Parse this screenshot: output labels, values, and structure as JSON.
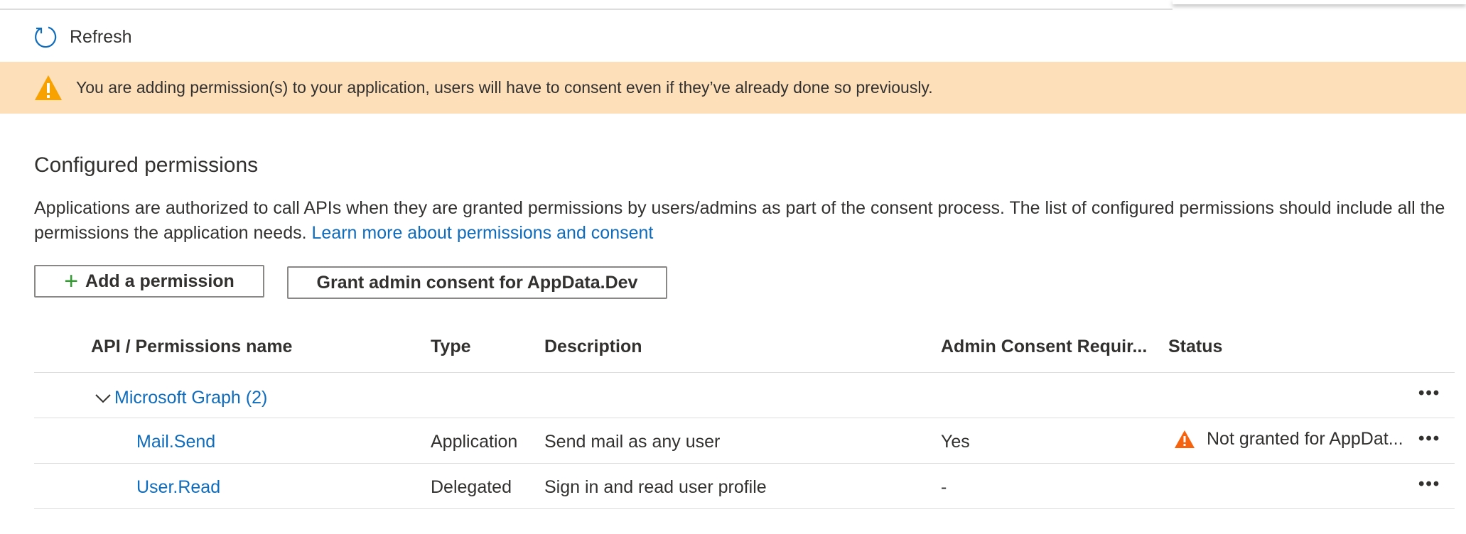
{
  "toolbar": {
    "refresh_label": "Refresh"
  },
  "banner": {
    "text": "You are adding permission(s) to your application, users will have to consent even if they’ve already done so previously."
  },
  "section": {
    "title": "Configured permissions",
    "description": "Applications are authorized to call APIs when they are granted permissions by users/admins as part of the consent process. The list of configured permissions should include all the permissions the application needs.",
    "learn_more": "Learn more about permissions and consent"
  },
  "buttons": {
    "add_permission": "Add a permission",
    "grant_consent": "Grant admin consent for AppData.Dev"
  },
  "table": {
    "headers": {
      "name": "API / Permissions name",
      "type": "Type",
      "description": "Description",
      "admin_consent": "Admin Consent Requir...",
      "status": "Status"
    },
    "group": {
      "label": "Microsoft Graph (2)"
    },
    "rows": [
      {
        "name": "Mail.Send",
        "type": "Application",
        "description": "Send mail as any user",
        "admin_consent": "Yes",
        "status": "Not granted for AppDat..."
      },
      {
        "name": "User.Read",
        "type": "Delegated",
        "description": "Sign in and read user profile",
        "admin_consent": "-",
        "status": ""
      }
    ],
    "more_glyph": "•••"
  },
  "colors": {
    "link": "#0f6cbd",
    "banner_bg": "#fddfb9",
    "warning": "#f7a200",
    "status_warning": "#f7630c",
    "plus": "#2f9e2f"
  },
  "icons": {
    "refresh": "refresh-icon",
    "warning": "warning-icon",
    "chevron": "chevron-down-icon",
    "more": "more-options-icon"
  }
}
